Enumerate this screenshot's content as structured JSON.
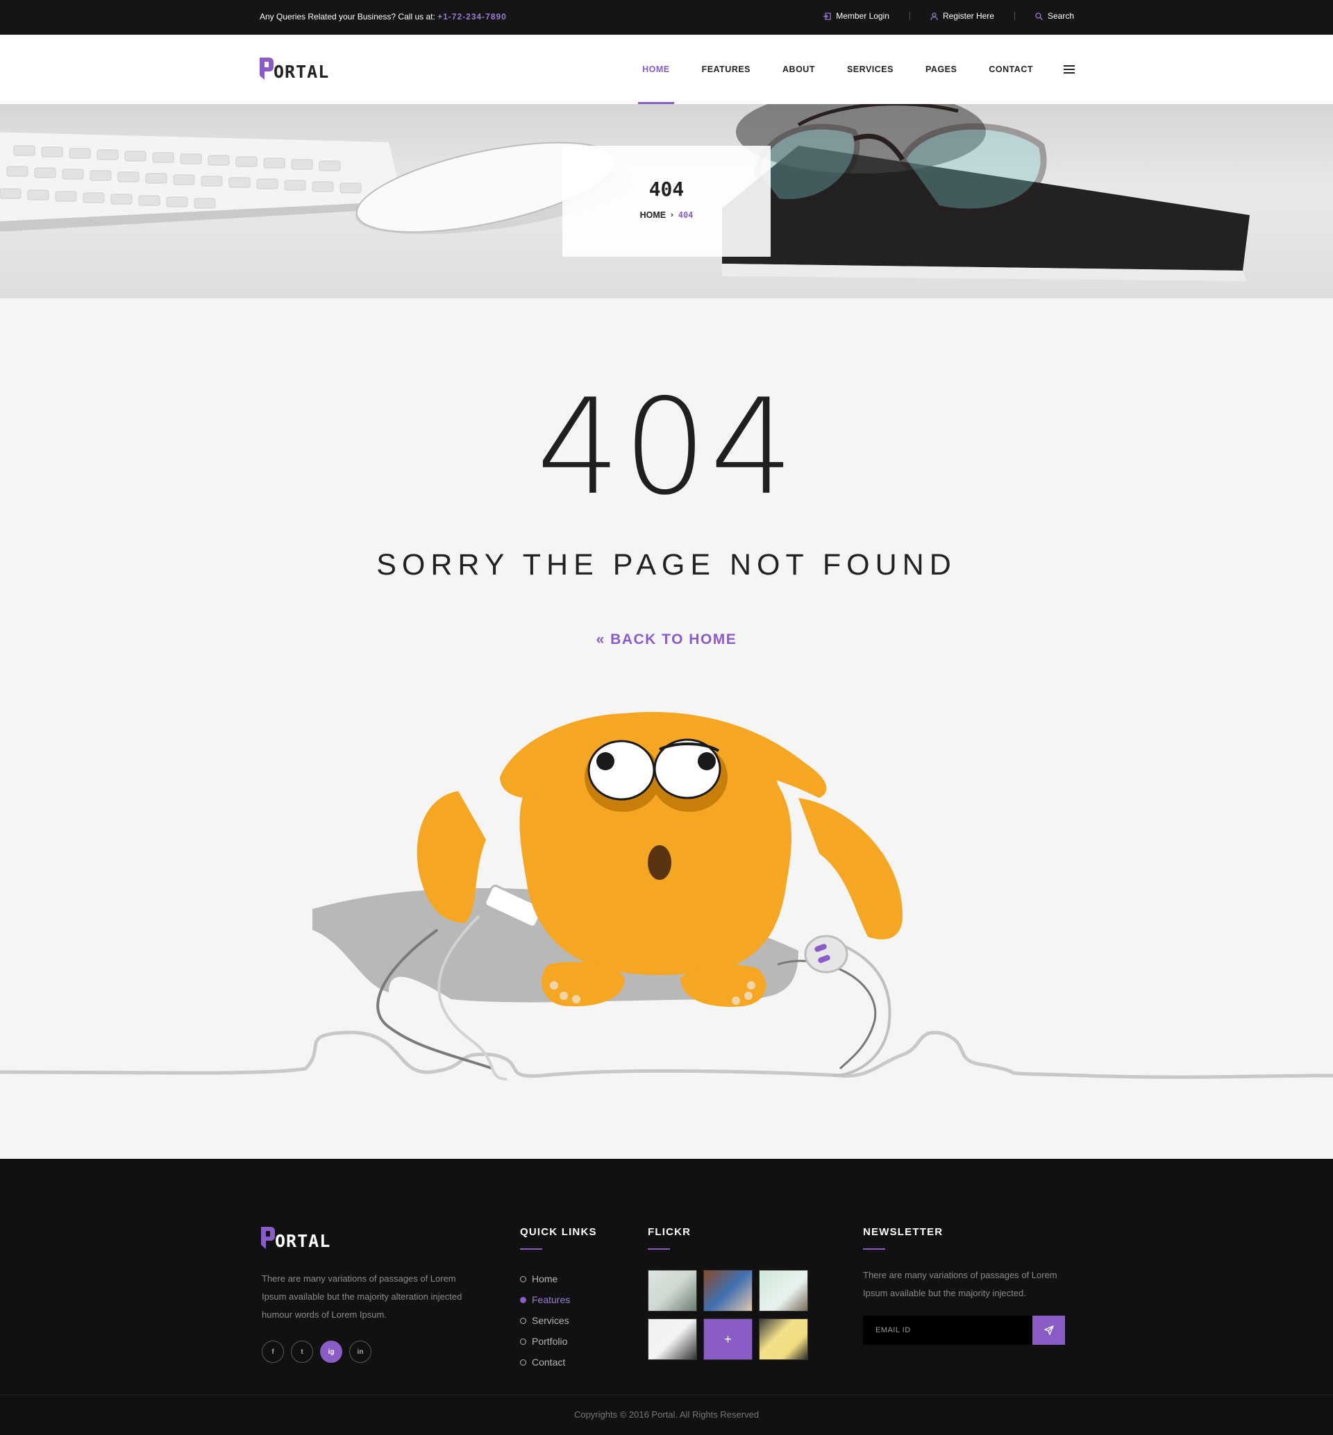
{
  "topbar": {
    "contact_text": "Any Queries Related your Business? Call us at: ",
    "phone": "+1-72-234-7890",
    "member_login": "Member Login",
    "register": "Register Here",
    "search": "Search"
  },
  "header": {
    "logo_rest": "ORTAL",
    "nav": [
      "HOME",
      "FEATURES",
      "ABOUT",
      "SERVICES",
      "PAGES",
      "CONTACT"
    ],
    "active_nav": "HOME"
  },
  "hero": {
    "title": "404",
    "breadcrumb_home": "HOME",
    "breadcrumb_current": "404"
  },
  "main": {
    "big_code": "404",
    "message": "SORRY THE PAGE NOT FOUND",
    "back_label": "« BACK TO HOME"
  },
  "footer": {
    "logo_rest": "ORTAL",
    "about": "There are many variations of passages of Lorem Ipsum available but the majority alteration injected humour words of Lorem Ipsum.",
    "socials": [
      "f",
      "t",
      "ig",
      "in"
    ],
    "quick_links_title": "QUICK LINKS",
    "quick_links": [
      "Home",
      "Features",
      "Services",
      "Portfolio",
      "Contact"
    ],
    "flickr_title": "FLICKR",
    "newsletter_title": "NEWSLETTER",
    "newsletter_text": "There are many variations of passages of Lorem Ipsum available but the majority injected.",
    "email_placeholder": "EMAIL ID",
    "copyright": "Copyrights © 2016 Portal. All Rights Reserved"
  },
  "colors": {
    "accent": "#8a5cc6",
    "dark": "#111111",
    "monster": "#f5a623"
  }
}
